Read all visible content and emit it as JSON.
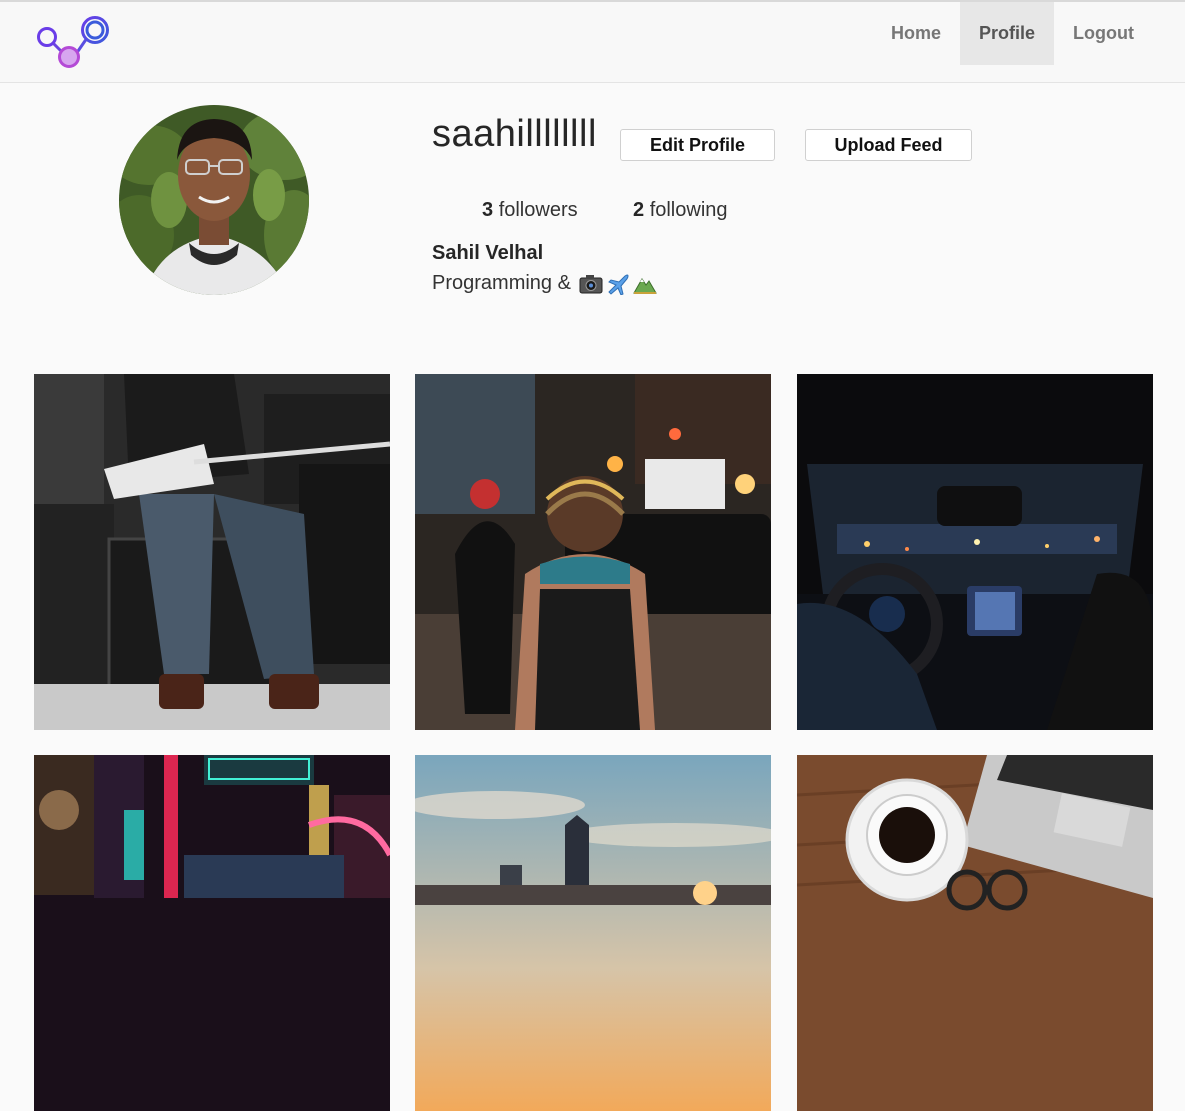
{
  "navbar": {
    "items": [
      {
        "label": "Home",
        "active": false
      },
      {
        "label": "Profile",
        "active": true
      },
      {
        "label": "Logout",
        "active": false
      }
    ]
  },
  "profile": {
    "username": "saahillllllll",
    "edit_label": "Edit Profile",
    "upload_label": "Upload Feed",
    "followers_count": "3",
    "followers_label": "followers",
    "following_count": "2",
    "following_label": "following",
    "full_name": "Sahil Velhal",
    "bio_text": "Programming &",
    "bio_emojis": [
      "camera-icon",
      "airplane-icon",
      "mountain-icon"
    ]
  },
  "colors": {
    "accent_purple": "#7b3fe4",
    "accent_blue": "#3b5bdb",
    "accent_magenta": "#c85ad8"
  },
  "feed": {
    "posts": [
      {
        "icon": "guitarist-photo"
      },
      {
        "icon": "city-street-photo"
      },
      {
        "icon": "car-night-photo"
      },
      {
        "icon": "neon-city-photo"
      },
      {
        "icon": "skyline-sunset-photo"
      },
      {
        "icon": "coffee-laptop-photo"
      }
    ]
  }
}
